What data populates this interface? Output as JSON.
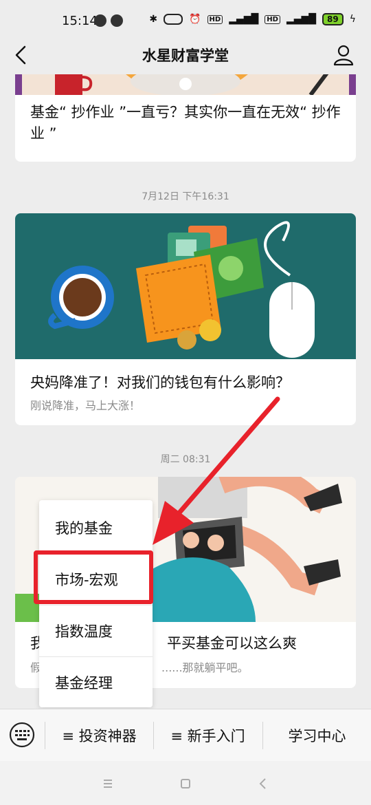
{
  "status": {
    "time": "15:14",
    "network": "4G",
    "battery": "89"
  },
  "nav": {
    "title": "水星财富学堂"
  },
  "feed": {
    "card1": {
      "title": "基金“ 抄作业 ”一直亏？其实你一直在无效“ 抄作业 ”"
    },
    "timestamp1": "7月12日 下午16:31",
    "card2": {
      "title": "央妈降准了！对我们的钱包有什么影响？",
      "subtitle": "刚说降准，马上大涨！"
    },
    "timestamp2": "周二 08:31",
    "card3": {
      "title_start": "我",
      "title_end": "平买基金可以这么爽",
      "subtitle_start": "假",
      "subtitle_end": "......那就躺平吧。"
    }
  },
  "popup_menu": {
    "items": [
      "我的基金",
      "市场-宏观",
      "指数温度",
      "基金经理"
    ]
  },
  "bottom_menu": {
    "items": [
      "≡ 投资神器",
      "≡ 新手入门",
      "学习中心"
    ]
  },
  "colors": {
    "highlight": "#e8222b",
    "card2_bg": "#1f6b6b",
    "accent_orange": "#f29a1c"
  }
}
